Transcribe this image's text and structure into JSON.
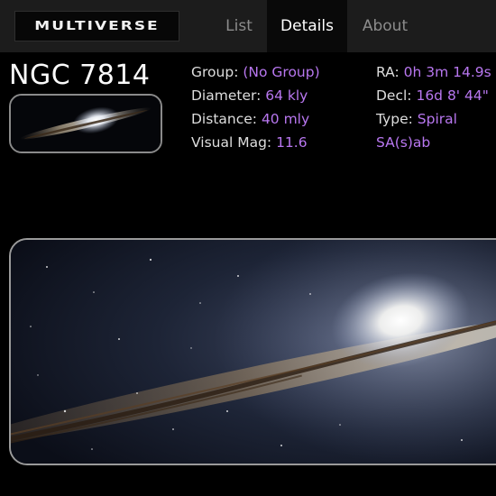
{
  "nav": {
    "logo": "MULTIVERSE",
    "tabs": [
      {
        "label": "List",
        "active": false
      },
      {
        "label": "Details",
        "active": true
      },
      {
        "label": "About",
        "active": false
      }
    ]
  },
  "object": {
    "name": "NGC 7814",
    "left_props": [
      {
        "key": "Group: ",
        "value": "(No Group)"
      },
      {
        "key": "Diameter: ",
        "value": "64 kly"
      },
      {
        "key": "Distance: ",
        "value": "40 mly"
      },
      {
        "key": "Visual Mag: ",
        "value": "11.6"
      }
    ],
    "right_props": [
      {
        "key": "RA: ",
        "value": "0h 3m 14.9s"
      },
      {
        "key": "Decl: ",
        "value": "16d 8' 44\""
      },
      {
        "key": "Type: ",
        "value": "Spiral"
      },
      {
        "key": "",
        "value": "SA(s)ab"
      }
    ]
  },
  "colors": {
    "accent": "#b877f0",
    "active_tab_bg": "#090909",
    "nav_bg": "#1c1c1c"
  },
  "images": {
    "thumbnail": "galaxy-thumbnail",
    "hero": "galaxy-image"
  }
}
